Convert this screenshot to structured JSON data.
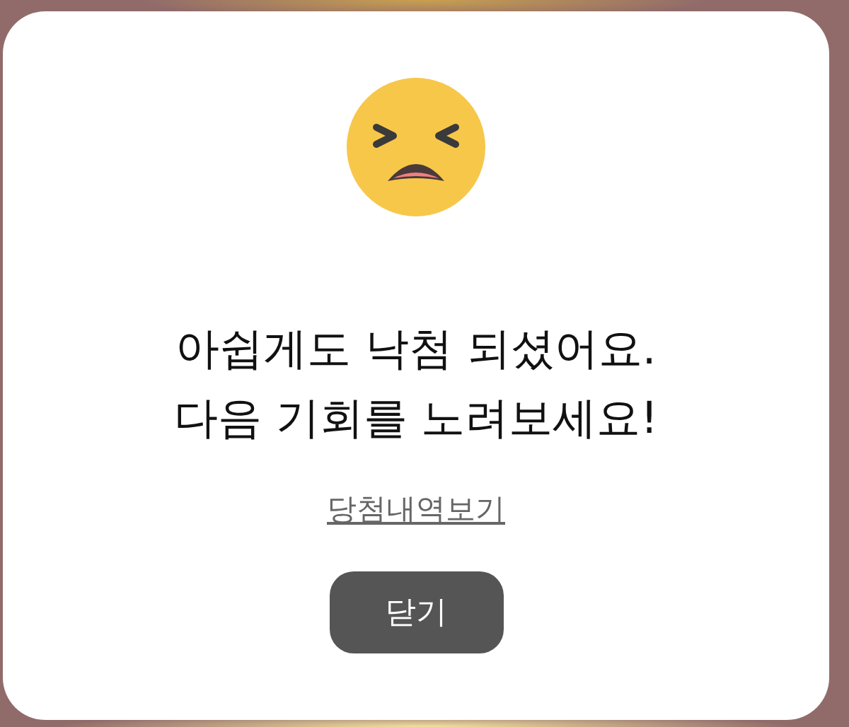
{
  "dialog": {
    "message_lines": [
      "아쉽게도 낙첨 되셨어요.",
      "다음 기회를 노려보세요!"
    ],
    "link": "당첨내역보기",
    "button": "닫기"
  }
}
